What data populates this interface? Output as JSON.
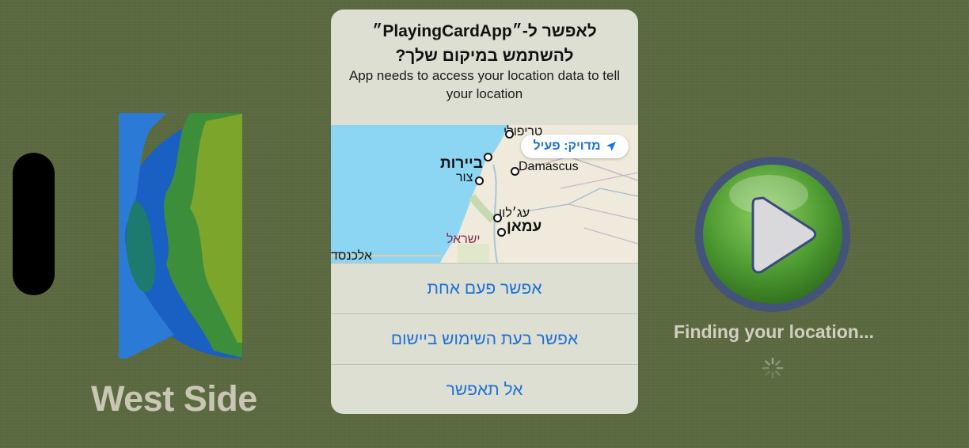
{
  "background": {
    "left_label": "West Side",
    "status_text": "Finding your location..."
  },
  "dialog": {
    "title_line1": "לאפשר ל-״PlayingCardApp״",
    "title_line2": "להשתמש במיקום שלך?",
    "message": "App needs to access your location data to tell your location",
    "precise_label": "מדויק: פעיל",
    "map_labels": {
      "tripoli": "טריפולי",
      "beirut": "ביירות",
      "damascus": "Damascus",
      "tyre": "צור",
      "ajloun": "עג׳לון",
      "amman": "עמאן",
      "israel": "ישראל",
      "alexandria": "אלכנסד"
    },
    "buttons": {
      "allow_once": "אפשר פעם אחת",
      "allow_while_using": "אפשר בעת השימוש ביישום",
      "dont_allow": "אל תאפשר"
    }
  },
  "colors": {
    "background": "#5b6a41",
    "accent_blue": "#1f6fd6",
    "play_green": "#4d9a31"
  },
  "icons": [
    "globe-icon",
    "play-icon",
    "location-arrow-icon",
    "spinner-icon"
  ]
}
